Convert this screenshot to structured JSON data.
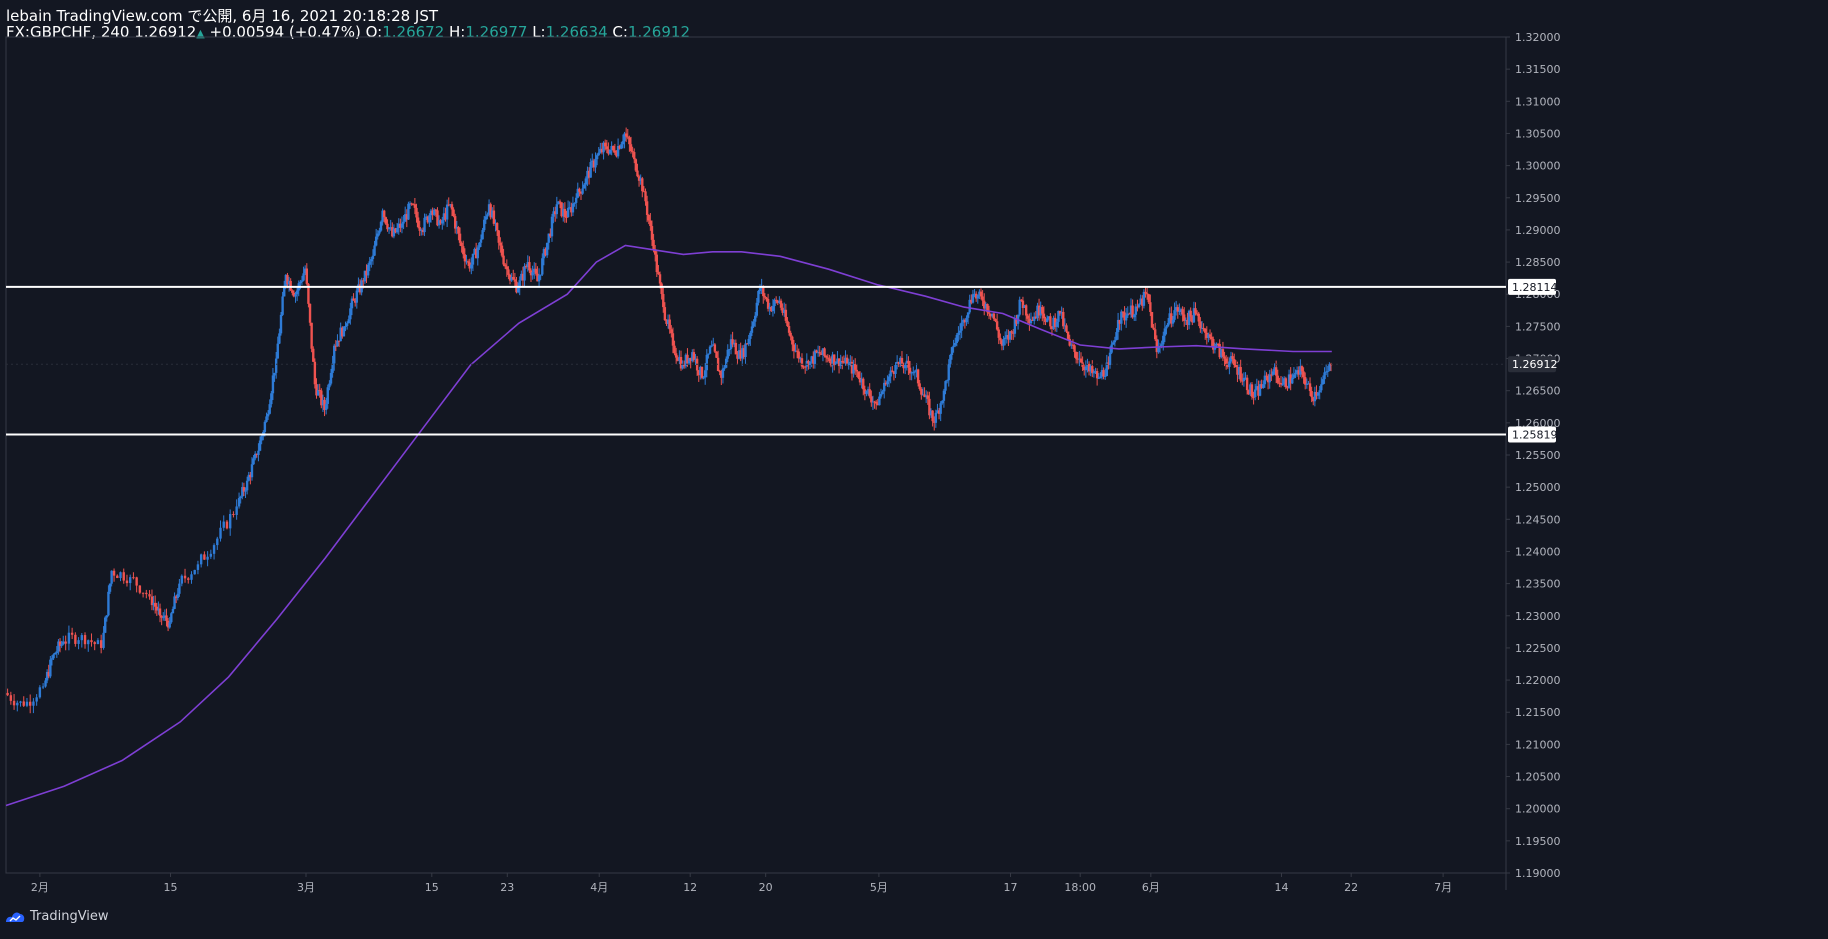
{
  "header": {
    "line1": "lebain TradingView.com で公開, 6月 16, 2021 20:18:28 JST",
    "symbol": "FX:GBPCHF, 240",
    "last": "1.26912",
    "change": "+0.00594 (+0.47%)",
    "o_label": "O:",
    "o_value": "1.26672",
    "h_label": "H:",
    "h_value": "1.26977",
    "l_label": "L:",
    "l_value": "1.26634",
    "c_label": "C:",
    "c_value": "1.26912"
  },
  "brand": {
    "name": "TradingView"
  },
  "colors": {
    "background": "#131722",
    "up": "#2e7bd6",
    "down": "#ef5350",
    "ma": "#7e3fd4",
    "level_line": "#ffffff",
    "axis_text": "#b2b5be"
  },
  "chart_data": {
    "type": "candlestick",
    "symbol": "FX:GBPCHF",
    "interval": "240",
    "ylim": [
      1.19,
      1.32
    ],
    "y_ticks": [
      "1.19000",
      "1.19500",
      "1.20000",
      "1.20500",
      "1.21000",
      "1.21500",
      "1.22000",
      "1.22500",
      "1.23000",
      "1.23500",
      "1.24000",
      "1.24500",
      "1.25000",
      "1.25500",
      "1.26000",
      "1.26500",
      "1.27000",
      "1.27500",
      "1.28000",
      "1.28500",
      "1.29000",
      "1.29500",
      "1.30000",
      "1.30500",
      "1.31000",
      "1.31500",
      "1.32000"
    ],
    "x_ticks": [
      {
        "label": "2月",
        "value": 0.5
      },
      {
        "label": "15",
        "value": 14
      },
      {
        "label": "3月",
        "value": 28
      },
      {
        "label": "15",
        "value": 41
      },
      {
        "label": "23",
        "value": 48.8
      },
      {
        "label": "4月",
        "value": 58.3
      },
      {
        "label": "12",
        "value": 67.7
      },
      {
        "label": "20",
        "value": 75.5
      },
      {
        "label": "5月",
        "value": 87.2
      },
      {
        "label": "17",
        "value": 100.8
      },
      {
        "label": "18:00",
        "value": 108
      },
      {
        "label": "6月",
        "value": 115.3
      },
      {
        "label": "14",
        "value": 128.8
      },
      {
        "label": "22",
        "value": 136
      },
      {
        "label": "7月",
        "value": 145.5
      }
    ],
    "x_range": [
      -3,
      152
    ],
    "levels": [
      {
        "label": "1.28114",
        "value": 1.28114
      },
      {
        "label": "1.25819",
        "value": 1.25819
      }
    ],
    "current_price": {
      "label": "1.26912",
      "value": 1.26912
    },
    "ma_points": [
      [
        -3,
        1.2005
      ],
      [
        3,
        1.2035
      ],
      [
        9,
        1.2075
      ],
      [
        15,
        1.2135
      ],
      [
        20,
        1.2205
      ],
      [
        25,
        1.2295
      ],
      [
        30,
        1.239
      ],
      [
        35,
        1.249
      ],
      [
        40,
        1.259
      ],
      [
        45,
        1.269
      ],
      [
        50,
        1.2755
      ],
      [
        55,
        1.28
      ],
      [
        58,
        1.285
      ],
      [
        61,
        1.2876
      ],
      [
        64,
        1.2869
      ],
      [
        67,
        1.2862
      ],
      [
        70,
        1.2866
      ],
      [
        73,
        1.2866
      ],
      [
        77,
        1.2859
      ],
      [
        82,
        1.2839
      ],
      [
        87,
        1.2815
      ],
      [
        92,
        1.2797
      ],
      [
        96,
        1.278
      ],
      [
        100,
        1.277
      ],
      [
        104,
        1.2745
      ],
      [
        108,
        1.2721
      ],
      [
        112,
        1.2715
      ],
      [
        116,
        1.2718
      ],
      [
        120,
        1.272
      ],
      [
        125,
        1.2715
      ],
      [
        130,
        1.2711
      ],
      [
        134,
        1.2711
      ]
    ],
    "price_points": [
      [
        -3,
        1.218
      ],
      [
        -1,
        1.216
      ],
      [
        1,
        1.219
      ],
      [
        2,
        1.224
      ],
      [
        3,
        1.226
      ],
      [
        5,
        1.227
      ],
      [
        7,
        1.225
      ],
      [
        8,
        1.237
      ],
      [
        10,
        1.236
      ],
      [
        12,
        1.233
      ],
      [
        13,
        1.23
      ],
      [
        14,
        1.229
      ],
      [
        15,
        1.235
      ],
      [
        17,
        1.238
      ],
      [
        19,
        1.242
      ],
      [
        21,
        1.247
      ],
      [
        22,
        1.251
      ],
      [
        23,
        1.255
      ],
      [
        24,
        1.261
      ],
      [
        25,
        1.27
      ],
      [
        26,
        1.283
      ],
      [
        27,
        1.28
      ],
      [
        28,
        1.284
      ],
      [
        29,
        1.266
      ],
      [
        30,
        1.262
      ],
      [
        31,
        1.272
      ],
      [
        32,
        1.275
      ],
      [
        33,
        1.279
      ],
      [
        34,
        1.282
      ],
      [
        35,
        1.286
      ],
      [
        36,
        1.293
      ],
      [
        37,
        1.289
      ],
      [
        38,
        1.291
      ],
      [
        39,
        1.294
      ],
      [
        40,
        1.29
      ],
      [
        41,
        1.293
      ],
      [
        42,
        1.291
      ],
      [
        43,
        1.294
      ],
      [
        44,
        1.288
      ],
      [
        45,
        1.284
      ],
      [
        46,
        1.288
      ],
      [
        47,
        1.294
      ],
      [
        48,
        1.288
      ],
      [
        49,
        1.283
      ],
      [
        50,
        1.281
      ],
      [
        51,
        1.285
      ],
      [
        52,
        1.282
      ],
      [
        53,
        1.288
      ],
      [
        54,
        1.294
      ],
      [
        55,
        1.292
      ],
      [
        56,
        1.295
      ],
      [
        57,
        1.298
      ],
      [
        58,
        1.301
      ],
      [
        59,
        1.303
      ],
      [
        60,
        1.302
      ],
      [
        61,
        1.305
      ],
      [
        62,
        1.301
      ],
      [
        63,
        1.296
      ],
      [
        64,
        1.287
      ],
      [
        65,
        1.278
      ],
      [
        66,
        1.272
      ],
      [
        67,
        1.269
      ],
      [
        68,
        1.271
      ],
      [
        69,
        1.267
      ],
      [
        70,
        1.272
      ],
      [
        71,
        1.267
      ],
      [
        72,
        1.273
      ],
      [
        73,
        1.27
      ],
      [
        74,
        1.274
      ],
      [
        75,
        1.281
      ],
      [
        76,
        1.278
      ],
      [
        77,
        1.279
      ],
      [
        78,
        1.274
      ],
      [
        79,
        1.27
      ],
      [
        80,
        1.269
      ],
      [
        81,
        1.271
      ],
      [
        82,
        1.27
      ],
      [
        83,
        1.27
      ],
      [
        84,
        1.269
      ],
      [
        85,
        1.268
      ],
      [
        86,
        1.265
      ],
      [
        87,
        1.263
      ],
      [
        88,
        1.266
      ],
      [
        89,
        1.269
      ],
      [
        90,
        1.269
      ],
      [
        91,
        1.268
      ],
      [
        92,
        1.264
      ],
      [
        93,
        1.26
      ],
      [
        94,
        1.265
      ],
      [
        95,
        1.272
      ],
      [
        96,
        1.276
      ],
      [
        97,
        1.28
      ],
      [
        98,
        1.279
      ],
      [
        99,
        1.277
      ],
      [
        100,
        1.272
      ],
      [
        101,
        1.274
      ],
      [
        102,
        1.279
      ],
      [
        103,
        1.276
      ],
      [
        104,
        1.278
      ],
      [
        105,
        1.275
      ],
      [
        106,
        1.277
      ],
      [
        107,
        1.272
      ],
      [
        108,
        1.27
      ],
      [
        109,
        1.268
      ],
      [
        110,
        1.267
      ],
      [
        111,
        1.269
      ],
      [
        112,
        1.276
      ],
      [
        113,
        1.277
      ],
      [
        114,
        1.278
      ],
      [
        115,
        1.28
      ],
      [
        116,
        1.271
      ],
      [
        117,
        1.275
      ],
      [
        118,
        1.278
      ],
      [
        119,
        1.276
      ],
      [
        120,
        1.277
      ],
      [
        121,
        1.274
      ],
      [
        122,
        1.272
      ],
      [
        123,
        1.27
      ],
      [
        124,
        1.269
      ],
      [
        125,
        1.267
      ],
      [
        126,
        1.264
      ],
      [
        127,
        1.266
      ],
      [
        128,
        1.268
      ],
      [
        129,
        1.266
      ],
      [
        130,
        1.267
      ],
      [
        131,
        1.268
      ],
      [
        132,
        1.264
      ],
      [
        133,
        1.266
      ],
      [
        134,
        1.2691
      ]
    ]
  }
}
